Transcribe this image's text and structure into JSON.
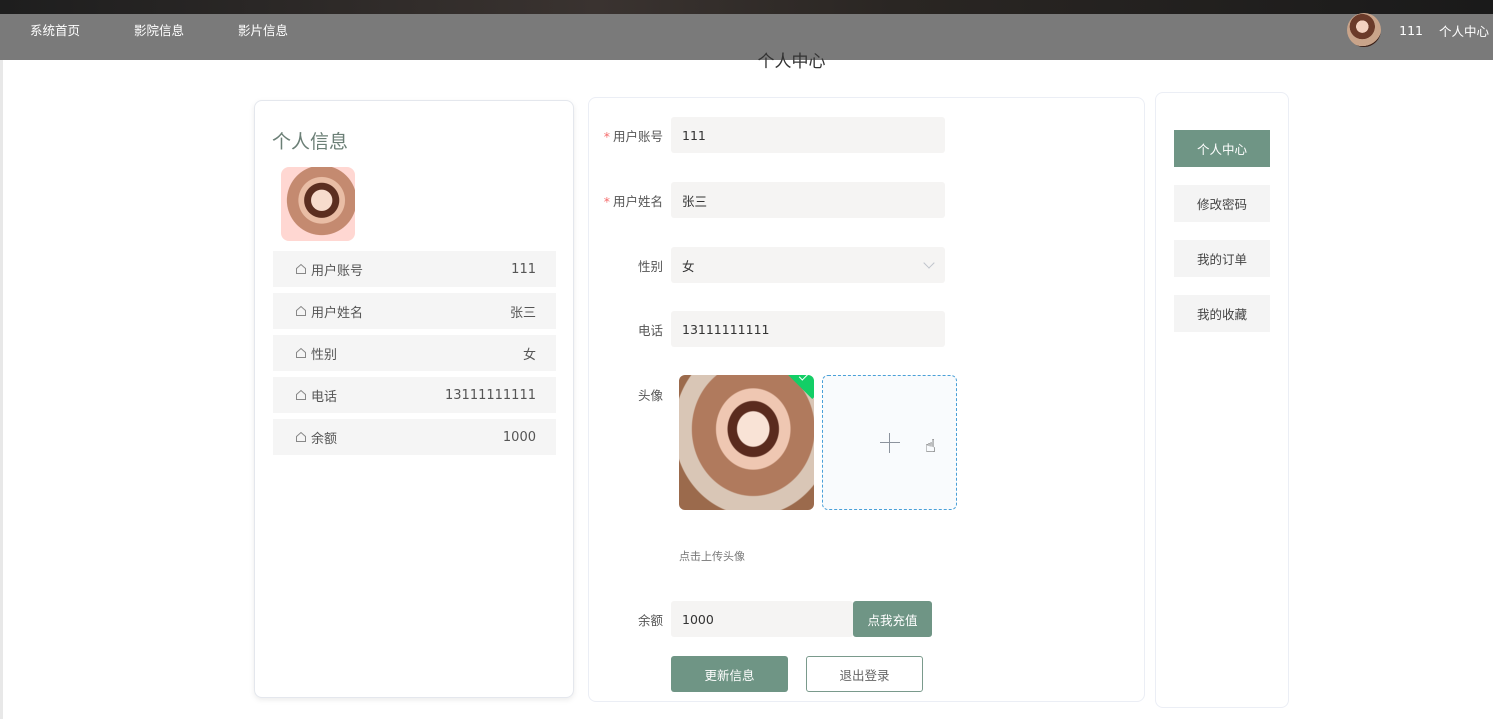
{
  "nav": {
    "items": [
      "系统首页",
      "影院信息",
      "影片信息"
    ]
  },
  "user": {
    "name": "111",
    "center_link": "个人中心"
  },
  "page_title": "个人中心",
  "profile_card": {
    "title": "个人信息",
    "rows": [
      {
        "label": "用户账号",
        "value": "111"
      },
      {
        "label": "用户姓名",
        "value": "张三"
      },
      {
        "label": "性别",
        "value": "女"
      },
      {
        "label": "电话",
        "value": "13111111111"
      },
      {
        "label": "余额",
        "value": "1000"
      }
    ]
  },
  "form": {
    "account": {
      "label": "用户账号",
      "required": "*",
      "value": "111"
    },
    "name": {
      "label": "用户姓名",
      "required": "*",
      "value": "张三"
    },
    "gender": {
      "label": "性别",
      "value": "女"
    },
    "phone": {
      "label": "电话",
      "value": "13111111111"
    },
    "avatar": {
      "label": "头像",
      "hint": "点击上传头像"
    },
    "balance": {
      "label": "余额",
      "value": "1000",
      "recharge_label": "点我充值"
    },
    "update_label": "更新信息",
    "logout_label": "退出登录"
  },
  "side_menu": {
    "items": [
      "个人中心",
      "修改密码",
      "我的订单",
      "我的收藏"
    ],
    "active_index": 0
  },
  "colors": {
    "accent": "#6f9585",
    "required": "#f56c6c",
    "topbar": "#7a7a7a"
  }
}
